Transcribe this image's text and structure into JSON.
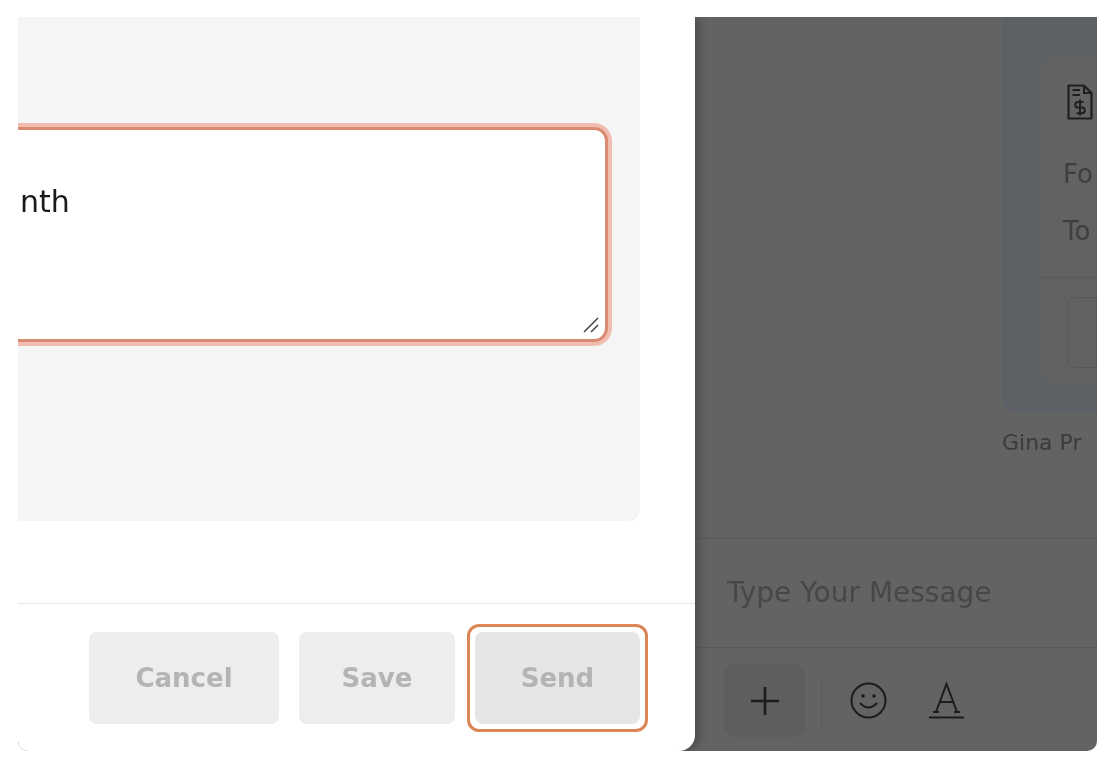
{
  "compose": {
    "message_field": {
      "value": "nth",
      "invalid": true
    },
    "buttons": [
      {
        "label": "Cancel",
        "disabled": true,
        "focused": false
      },
      {
        "label": "Save",
        "disabled": true,
        "focused": false
      },
      {
        "label": "Send",
        "disabled": true,
        "focused": true
      }
    ]
  },
  "chat": {
    "invoice_card": {
      "lines": [
        "Fo",
        "To"
      ]
    },
    "sender": "Gina Pr",
    "composer": {
      "placeholder": "Type Your Message"
    }
  }
}
